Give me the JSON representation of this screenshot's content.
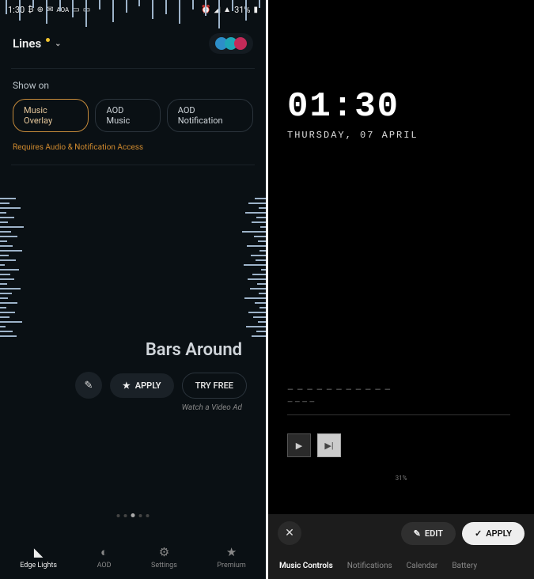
{
  "left": {
    "statusbar": {
      "time": "1:30",
      "icons_left": [
        "₿",
        "⊕",
        "✉",
        "AOA",
        "⊡",
        "⊡",
        "⊡"
      ],
      "icons_right": [
        "⏰",
        "📶",
        "📶",
        "31%",
        "🔋"
      ],
      "battery_text": "31%"
    },
    "header": {
      "title": "Lines",
      "colors": [
        "#2d8ec9",
        "#1ea6b7",
        "#c42a58"
      ]
    },
    "section_label": "Show on",
    "chips": [
      {
        "label": "Music Overlay",
        "active": true
      },
      {
        "label": "AOD Music",
        "active": false
      },
      {
        "label": "AOD Notification",
        "active": false
      }
    ],
    "permission_note": "Requires Audio & Notification Access",
    "effect_title": "Bars Around",
    "actions": {
      "apply": "APPLY",
      "tryfree": "TRY FREE",
      "ad_note": "Watch a Video Ad"
    },
    "nav": [
      {
        "label": "Edge Lights",
        "icon": "➤",
        "active": true
      },
      {
        "label": "AOD",
        "icon": "◐",
        "active": false
      },
      {
        "label": "Settings",
        "icon": "⚙",
        "active": false
      },
      {
        "label": "Premium",
        "icon": "★",
        "active": false
      }
    ]
  },
  "right": {
    "clock": "01:30",
    "date": "THURSDAY, 07 APRIL",
    "track_line": "— — — — — — — — — — —",
    "track_line2": "— — — —",
    "battery": "31%",
    "actions": {
      "edit": "EDIT",
      "apply": "APPLY"
    },
    "tabs": [
      {
        "label": "Music Controls",
        "active": true
      },
      {
        "label": "Notifications",
        "active": false
      },
      {
        "label": "Calendar",
        "active": false
      },
      {
        "label": "Battery",
        "active": false
      }
    ]
  }
}
